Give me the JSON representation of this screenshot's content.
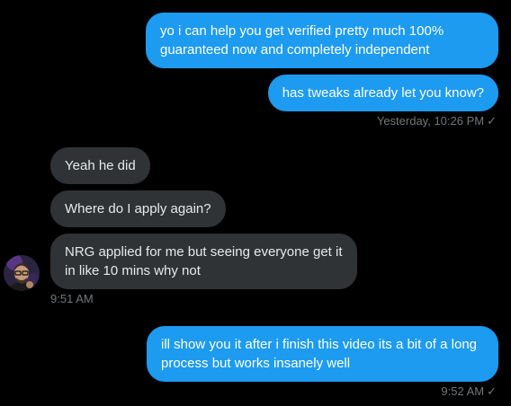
{
  "colors": {
    "background": "#000000",
    "outgoing_bubble": "#1d9bf0",
    "incoming_bubble": "#2f3336",
    "timestamp": "#71767b"
  },
  "messages": [
    {
      "direction": "outgoing",
      "lines": [
        "yo i can help you get verified pretty much 100%",
        "guaranteed now and completely independent"
      ]
    },
    {
      "direction": "outgoing",
      "lines": [
        "has tweaks already let you know?"
      ]
    },
    {
      "direction": "incoming",
      "lines": [
        "Yeah he did"
      ]
    },
    {
      "direction": "incoming",
      "lines": [
        "Where do I apply again?"
      ]
    },
    {
      "direction": "incoming",
      "lines": [
        "NRG applied for me but seeing everyone get it",
        "in like 10 mins why not"
      ]
    },
    {
      "direction": "outgoing",
      "lines": [
        "ill show you it after i finish this video its a bit of a long",
        "process but works insanely well"
      ]
    }
  ],
  "timestamps": {
    "first_group": "Yesterday, 10:26 PM",
    "incoming_group": "9:51 AM",
    "last_group": "9:52 AM"
  },
  "icons": {
    "read_receipt": "check-icon",
    "avatar": "avatar"
  },
  "read_receipt_glyph": "✓"
}
